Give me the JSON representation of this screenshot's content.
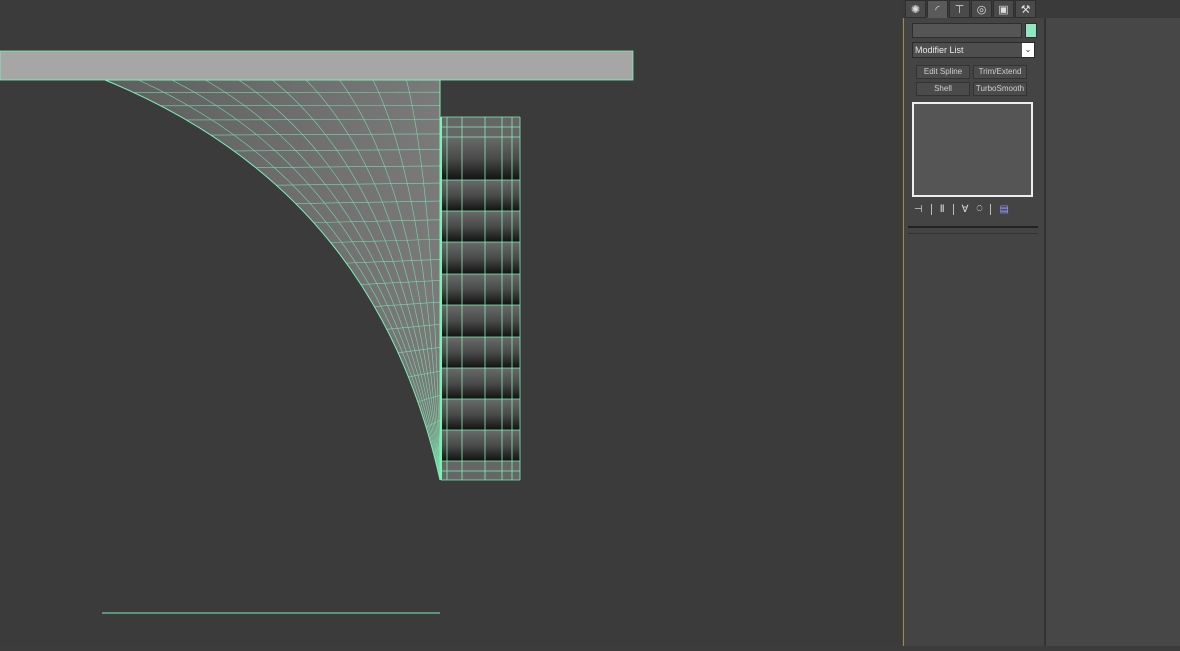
{
  "panel": {
    "tabs": [
      {
        "icon": "create-icon",
        "glyph": "✺"
      },
      {
        "icon": "modify-icon",
        "glyph": "◜"
      },
      {
        "icon": "hierarchy-icon",
        "glyph": "⊤"
      },
      {
        "icon": "motion-icon",
        "glyph": "◎"
      },
      {
        "icon": "display-icon",
        "glyph": "▣"
      },
      {
        "icon": "utilities-icon",
        "glyph": "⚒"
      }
    ],
    "swatch_color": "#8fe8c0",
    "modifier_list": "Modifier List",
    "buttons": [
      "Edit Spline",
      "Trim/Extend",
      "Shell",
      "TurboSmooth"
    ],
    "stack_tools": [
      {
        "icon": "pin-stack-icon",
        "glyph": "⊣"
      },
      {
        "icon": "show-end-result-icon",
        "glyph": "Ⅱ"
      },
      {
        "icon": "make-unique-icon",
        "glyph": "∀"
      },
      {
        "icon": "remove-modifier-icon",
        "glyph": "⍥"
      },
      {
        "icon": "configure-modifier-sets-icon",
        "glyph": "▤"
      }
    ]
  },
  "viewport": {
    "wire_color": "#7df0b4"
  }
}
